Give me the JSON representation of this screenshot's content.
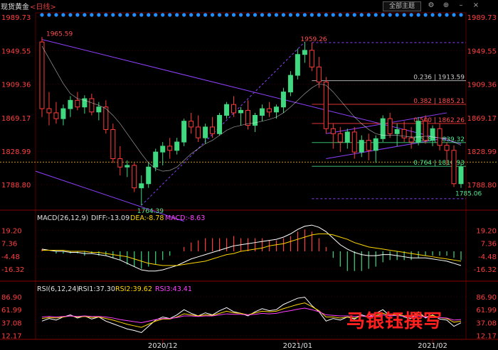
{
  "header": {
    "title": "现货黄金",
    "period": "<日线>",
    "theme_button": "全部主题",
    "icons": [
      "settings-icon",
      "expand-icon",
      "minimize-icon",
      "close-icon"
    ]
  },
  "colors": {
    "up": "#40d880",
    "down": "#ff3c3c",
    "grid": "#3a0000",
    "trend": "#9040ff",
    "dea": "#ffd700",
    "macd": "#ff40ff",
    "dots": "#1e90ff"
  },
  "watermark": "马银钰撰写",
  "chart_data": [
    {
      "type": "candlestick",
      "title": "现货黄金 <日线>",
      "y_ticks": [
        "1989.73",
        "1949.55",
        "1909.36",
        "1869.17",
        "1828.99",
        "1788.80"
      ],
      "ylim": [
        1760,
        1995
      ],
      "x_ticks": [
        "2020/12",
        "2021/01",
        "2021/02"
      ],
      "annotations": [
        {
          "label": "1965.59",
          "value": 1965.59
        },
        {
          "label": "1959.26",
          "value": 1959.26
        },
        {
          "label": "1764.39",
          "value": 1764.39
        },
        {
          "label": "1785.06",
          "value": 1785.06
        }
      ],
      "fibonacci": [
        {
          "label": "0.236 | 1913.59",
          "value": 1913.59
        },
        {
          "label": "0.382 | 1885.21",
          "value": 1885.21
        },
        {
          "label": "0.500 | 1862.26",
          "value": 1862.26
        },
        {
          "label": "0.618 | 1839.32",
          "value": 1839.32
        },
        {
          "label": "0.764 | 1810.93",
          "value": 1810.93
        }
      ],
      "candles": [
        [
          1960,
          1966,
          1870,
          1880
        ],
        [
          1880,
          1900,
          1860,
          1875
        ],
        [
          1875,
          1888,
          1862,
          1868
        ],
        [
          1868,
          1885,
          1860,
          1880
        ],
        [
          1880,
          1895,
          1870,
          1890
        ],
        [
          1890,
          1900,
          1878,
          1882
        ],
        [
          1882,
          1896,
          1874,
          1892
        ],
        [
          1892,
          1898,
          1872,
          1876
        ],
        [
          1876,
          1888,
          1866,
          1882
        ],
        [
          1882,
          1890,
          1850,
          1855
        ],
        [
          1855,
          1862,
          1815,
          1820
        ],
        [
          1820,
          1835,
          1800,
          1810
        ],
        [
          1810,
          1818,
          1798,
          1812
        ],
        [
          1812,
          1815,
          1780,
          1785
        ],
        [
          1785,
          1800,
          1764,
          1790
        ],
        [
          1790,
          1815,
          1785,
          1810
        ],
        [
          1810,
          1832,
          1805,
          1828
        ],
        [
          1828,
          1840,
          1812,
          1835
        ],
        [
          1835,
          1845,
          1820,
          1830
        ],
        [
          1830,
          1845,
          1825,
          1840
        ],
        [
          1840,
          1868,
          1835,
          1865
        ],
        [
          1865,
          1875,
          1850,
          1858
        ],
        [
          1858,
          1872,
          1840,
          1845
        ],
        [
          1845,
          1862,
          1838,
          1858
        ],
        [
          1858,
          1870,
          1845,
          1850
        ],
        [
          1850,
          1875,
          1848,
          1872
        ],
        [
          1872,
          1888,
          1868,
          1885
        ],
        [
          1885,
          1895,
          1870,
          1875
        ],
        [
          1875,
          1882,
          1860,
          1878
        ],
        [
          1878,
          1890,
          1855,
          1860
        ],
        [
          1860,
          1875,
          1852,
          1872
        ],
        [
          1872,
          1885,
          1865,
          1880
        ],
        [
          1880,
          1888,
          1870,
          1876
        ],
        [
          1876,
          1885,
          1868,
          1882
        ],
        [
          1882,
          1905,
          1875,
          1900
        ],
        [
          1900,
          1925,
          1895,
          1920
        ],
        [
          1920,
          1952,
          1915,
          1945
        ],
        [
          1945,
          1960,
          1935,
          1950
        ],
        [
          1950,
          1959,
          1925,
          1930
        ],
        [
          1930,
          1942,
          1905,
          1912
        ],
        [
          1912,
          1918,
          1850,
          1856
        ],
        [
          1856,
          1862,
          1832,
          1850
        ],
        [
          1850,
          1858,
          1828,
          1840
        ],
        [
          1840,
          1856,
          1832,
          1852
        ],
        [
          1852,
          1858,
          1820,
          1828
        ],
        [
          1828,
          1848,
          1822,
          1842
        ],
        [
          1842,
          1850,
          1818,
          1830
        ],
        [
          1830,
          1848,
          1815,
          1844
        ],
        [
          1844,
          1872,
          1840,
          1868
        ],
        [
          1868,
          1875,
          1845,
          1850
        ],
        [
          1850,
          1862,
          1835,
          1855
        ],
        [
          1855,
          1865,
          1840,
          1845
        ],
        [
          1845,
          1858,
          1832,
          1840
        ],
        [
          1840,
          1870,
          1836,
          1865
        ],
        [
          1865,
          1872,
          1838,
          1842
        ],
        [
          1842,
          1860,
          1835,
          1856
        ],
        [
          1856,
          1862,
          1830,
          1836
        ],
        [
          1836,
          1840,
          1812,
          1830
        ],
        [
          1830,
          1836,
          1786,
          1790
        ],
        [
          1790,
          1815,
          1785,
          1810
        ]
      ],
      "moving_average": [
        1955,
        1940,
        1925,
        1910,
        1898,
        1892,
        1890,
        1887,
        1884,
        1880,
        1872,
        1862,
        1850,
        1838,
        1826,
        1815,
        1808,
        1805,
        1806,
        1810,
        1818,
        1826,
        1832,
        1838,
        1842,
        1848,
        1854,
        1858,
        1860,
        1862,
        1863,
        1865,
        1867,
        1870,
        1875,
        1882,
        1890,
        1898,
        1905,
        1910,
        1908,
        1900,
        1890,
        1880,
        1870,
        1862,
        1855,
        1850,
        1848,
        1848,
        1848,
        1847,
        1846,
        1846,
        1847,
        1846,
        1845,
        1844,
        1840,
        1836
      ]
    },
    {
      "type": "bar",
      "title": "MACD(26,12,9)",
      "series": [
        {
          "name": "DIFF",
          "label": "DIFF:-13.09",
          "values": [
            2,
            1,
            0,
            0,
            -1,
            -1,
            -2,
            -2,
            -3,
            -4,
            -6,
            -8,
            -11,
            -14,
            -17,
            -18,
            -18,
            -17,
            -15,
            -13,
            -10,
            -7,
            -5,
            -3,
            -1,
            1,
            3,
            5,
            6,
            7,
            8,
            9,
            10,
            11,
            13,
            16,
            20,
            23,
            24,
            22,
            18,
            12,
            6,
            2,
            -1,
            -3,
            -4,
            -4,
            -3,
            -3,
            -4,
            -5,
            -6,
            -6,
            -6,
            -7,
            -8,
            -9,
            -11,
            -13
          ]
        },
        {
          "name": "DEA",
          "label": "DEA:-8.78",
          "values": [
            1,
            1,
            1,
            1,
            0,
            0,
            0,
            -1,
            -1,
            -2,
            -3,
            -4,
            -5,
            -7,
            -9,
            -11,
            -12,
            -13,
            -13,
            -13,
            -12,
            -11,
            -10,
            -9,
            -7,
            -5,
            -3,
            -2,
            0,
            1,
            2,
            3,
            5,
            6,
            7,
            9,
            11,
            13,
            15,
            16,
            16,
            15,
            13,
            11,
            8,
            6,
            4,
            3,
            2,
            1,
            0,
            -1,
            -2,
            -3,
            -4,
            -5,
            -6,
            -7,
            -8,
            -9
          ]
        },
        {
          "name": "MACD",
          "label": "MACD:-8.63",
          "values": [
            2,
            0,
            -2,
            -2,
            -2,
            -2,
            -4,
            -2,
            -4,
            -4,
            -6,
            -8,
            -12,
            -14,
            -16,
            -14,
            -12,
            -8,
            -4,
            0,
            4,
            8,
            10,
            12,
            12,
            12,
            12,
            14,
            12,
            12,
            12,
            12,
            10,
            10,
            12,
            14,
            18,
            20,
            18,
            12,
            4,
            -6,
            -14,
            -18,
            -18,
            -18,
            -16,
            -14,
            -10,
            -8,
            -8,
            -8,
            -8,
            -6,
            -4,
            -4,
            -4,
            -4,
            -6,
            -8
          ]
        }
      ],
      "y_ticks": [
        "19.20",
        "7.36",
        "-4.48",
        "-16.32"
      ],
      "ylim": [
        -26,
        26
      ]
    },
    {
      "type": "line",
      "title": "RSI(6,12,24)",
      "series": [
        {
          "name": "RSI1",
          "label": "RSI1:37.30",
          "values": [
            40,
            45,
            42,
            48,
            52,
            46,
            50,
            44,
            48,
            40,
            35,
            30,
            25,
            22,
            18,
            30,
            42,
            48,
            45,
            52,
            62,
            55,
            50,
            56,
            52,
            60,
            66,
            58,
            55,
            50,
            58,
            64,
            60,
            62,
            72,
            78,
            84,
            86,
            70,
            58,
            40,
            45,
            42,
            48,
            44,
            52,
            48,
            55,
            62,
            50,
            55,
            48,
            45,
            58,
            46,
            52,
            44,
            42,
            30,
            37
          ]
        },
        {
          "name": "RSI2",
          "label": "RSI2:39.62",
          "values": [
            45,
            47,
            46,
            48,
            50,
            48,
            49,
            47,
            48,
            45,
            42,
            38,
            34,
            31,
            28,
            34,
            40,
            44,
            44,
            48,
            54,
            52,
            50,
            52,
            51,
            55,
            59,
            56,
            55,
            52,
            56,
            59,
            58,
            59,
            64,
            68,
            72,
            75,
            68,
            60,
            48,
            48,
            46,
            48,
            46,
            50,
            48,
            51,
            55,
            51,
            53,
            50,
            48,
            53,
            48,
            51,
            47,
            45,
            38,
            40
          ]
        },
        {
          "name": "RSI3",
          "label": "RSI3:43.41",
          "values": [
            48,
            49,
            48,
            49,
            50,
            49,
            50,
            49,
            49,
            48,
            46,
            43,
            41,
            39,
            37,
            40,
            43,
            45,
            45,
            47,
            50,
            50,
            49,
            50,
            50,
            52,
            54,
            53,
            53,
            52,
            53,
            55,
            54,
            55,
            58,
            60,
            63,
            65,
            62,
            58,
            52,
            51,
            50,
            50,
            49,
            50,
            49,
            50,
            52,
            50,
            51,
            49,
            48,
            50,
            48,
            49,
            47,
            46,
            42,
            43
          ]
        }
      ],
      "y_ticks": [
        "86.90",
        "61.99",
        "37.08",
        "12.17"
      ],
      "ylim": [
        5,
        95
      ]
    }
  ]
}
